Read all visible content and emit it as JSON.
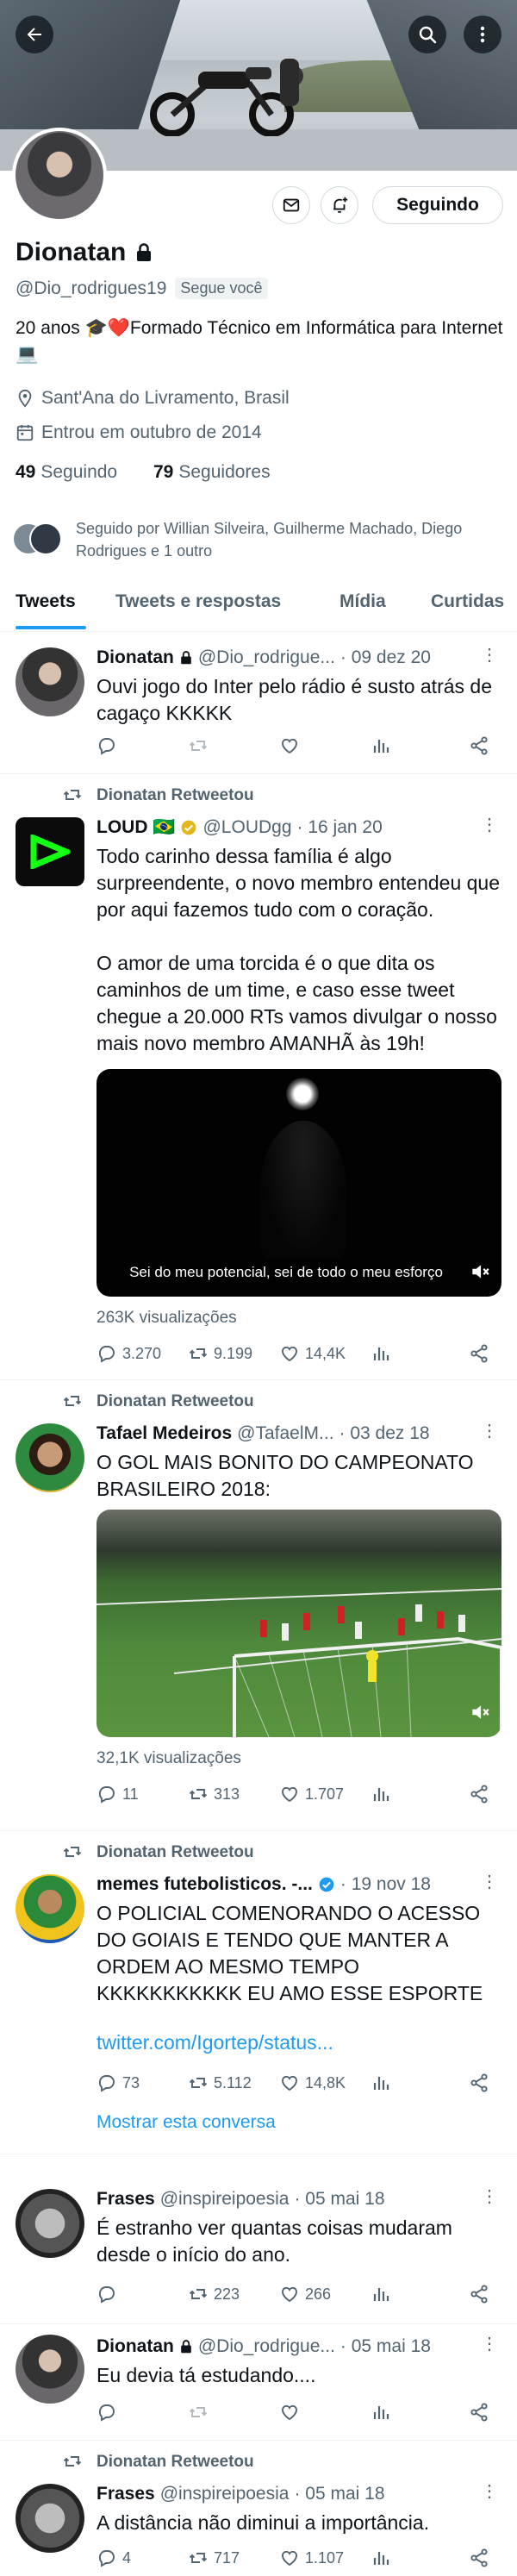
{
  "profile": {
    "name": "Dionatan",
    "handle": "@Dio_rodrigues19",
    "follows_you": "Segue você",
    "bio": "20 anos 🎓❤️Formado Técnico em Informática para Internet💻",
    "location": "Sant'Ana do Livramento, Brasil",
    "joined": "Entrou em outubro de 2014",
    "following_count": "49",
    "following_label": "Seguindo",
    "followers_count": "79",
    "followers_label": "Seguidores",
    "followed_by": "Seguido por Willian Silveira, Guilherme Machado, Diego Rodrigues e 1 outro",
    "follow_button": "Seguindo"
  },
  "tabs": [
    {
      "label": "Tweets"
    },
    {
      "label": "Tweets e respostas"
    },
    {
      "label": "Mídia"
    },
    {
      "label": "Curtidas"
    }
  ],
  "colors": {
    "accent": "#1d9bf0",
    "muted": "#536471",
    "verified": "#1d9bf0",
    "gold": "#e2b719"
  },
  "tweets": [
    {
      "name": "Dionatan",
      "handle": "@Dio_rodrigue...",
      "date": "· 09 dez 20",
      "text": "Ouvi jogo do Inter pelo rádio é susto atrás de cagaço KKKKK"
    },
    {
      "retweet_label": "Dionatan Retweetou",
      "name": "LOUD 🇧🇷",
      "handle": "@LOUDgg",
      "date": "· 16 jan 20",
      "text1": "Todo carinho dessa família é algo surpreendente, o novo membro entendeu que por aqui fazemos tudo com o coração.",
      "text2": "O amor de uma torcida é o que dita os caminhos de um time, e caso esse tweet chegue a 20.000 RTs vamos divulgar o nosso mais novo membro AMANHÃ às 19h!",
      "caption": "Sei do meu potencial, sei de todo o meu esforço",
      "views": "263K visualizações",
      "replies": "3.270",
      "retweets": "9.199",
      "likes": "14,4K"
    },
    {
      "retweet_label": "Dionatan Retweetou",
      "name": "Tafael Medeiros",
      "handle": "@TafaelM...",
      "date": "· 03 dez 18",
      "text": "O GOL MAIS BONITO DO CAMPEONATO BRASILEIRO 2018:",
      "views": "32,1K visualizações",
      "replies": "11",
      "retweets": "313",
      "likes": "1.707"
    },
    {
      "retweet_label": "Dionatan Retweetou",
      "name": "memes futebolisticos. -...",
      "date": "· 19 nov 18",
      "text": "O POLICIAL COMENORANDO O ACESSO DO GOIAIS E TENDO QUE MANTER A ORDEM AO MESMO TEMPO KKKKKKKKKKK EU AMO ESSE ESPORTE",
      "link": "twitter.com/Igortep/status...",
      "replies": "73",
      "retweets": "5.112",
      "likes": "14,8K",
      "show_thread": "Mostrar esta conversa"
    },
    {
      "name": "Frases",
      "handle": "@inspireipoesia",
      "date": "· 05 mai 18",
      "text": "É estranho ver quantas coisas mudaram desde o início do ano.",
      "retweets": "223",
      "likes": "266"
    },
    {
      "name": "Dionatan",
      "handle": "@Dio_rodrigue...",
      "date": "· 05 mai 18",
      "text": "Eu devia tá estudando...."
    },
    {
      "retweet_label": "Dionatan Retweetou",
      "name": "Frases",
      "handle": "@inspireipoesia",
      "date": "· 05 mai 18",
      "text": "A distância não diminui a importância.",
      "replies": "4",
      "retweets": "717",
      "likes": "1.107"
    }
  ]
}
